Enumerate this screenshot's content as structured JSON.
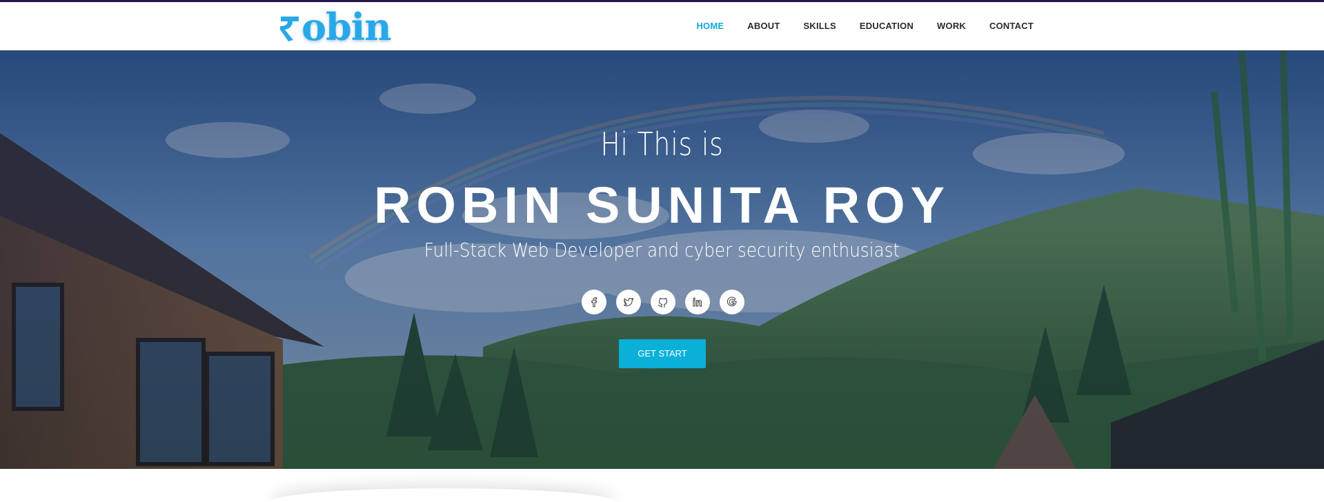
{
  "brand": {
    "logo_text": "obin",
    "logo_alt": "Robin logo"
  },
  "nav": {
    "items": [
      {
        "label": "HOME",
        "active": true
      },
      {
        "label": "ABOUT",
        "active": false
      },
      {
        "label": "SKILLS",
        "active": false
      },
      {
        "label": "EDUCATION",
        "active": false
      },
      {
        "label": "WORK",
        "active": false
      },
      {
        "label": "CONTACT",
        "active": false
      }
    ]
  },
  "hero": {
    "intro": "Hi This is",
    "name": "ROBIN SUNITA ROY",
    "tagline": "Full-Stack Web Developer and cyber security enthusiast",
    "cta_label": "GET START",
    "socials": [
      {
        "icon": "facebook-icon"
      },
      {
        "icon": "twitter-icon"
      },
      {
        "icon": "github-icon"
      },
      {
        "icon": "linkedin-icon"
      },
      {
        "icon": "google-icon"
      }
    ]
  },
  "colors": {
    "accent": "#0ab0d8",
    "nav_active": "#10a9d8",
    "logo": "#29a8e8",
    "top_strip": "#24164a",
    "nav_text": "#2b2b2b"
  }
}
